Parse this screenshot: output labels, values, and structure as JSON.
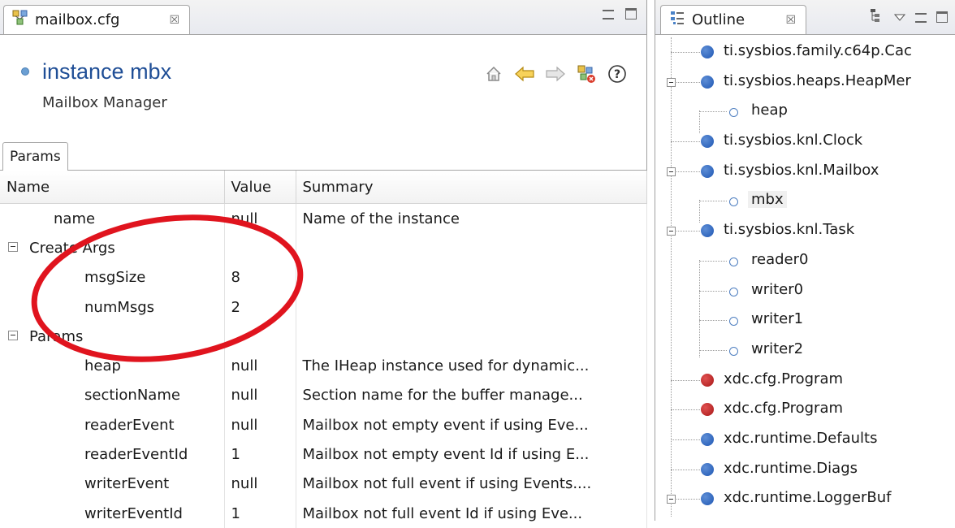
{
  "editor": {
    "tab_label": "mailbox.cfg",
    "tab_close": "☒",
    "instance_title": "instance mbx",
    "instance_subtitle": "Mailbox Manager",
    "params_tab": "Params",
    "columns": [
      "Name",
      "Value",
      "Summary"
    ],
    "rows": [
      {
        "name": "name",
        "value": "null",
        "summary": "Name of the instance",
        "level": 1
      },
      {
        "name": "Create Args",
        "value": "",
        "summary": "",
        "level": 0,
        "group": true
      },
      {
        "name": "msgSize",
        "value": "8",
        "summary": "",
        "level": 2
      },
      {
        "name": "numMsgs",
        "value": "2",
        "summary": "",
        "level": 2
      },
      {
        "name": "Params",
        "value": "",
        "summary": "",
        "level": 0,
        "group": true
      },
      {
        "name": "heap",
        "value": "null",
        "summary": "The IHeap instance used for dynamic...",
        "level": 2
      },
      {
        "name": "sectionName",
        "value": "null",
        "summary": "Section name for the buffer manage...",
        "level": 2
      },
      {
        "name": "readerEvent",
        "value": "null",
        "summary": "Mailbox not empty event if using Eve...",
        "level": 2
      },
      {
        "name": "readerEventId",
        "value": "1",
        "summary": "Mailbox not empty event Id if using E...",
        "level": 2
      },
      {
        "name": "writerEvent",
        "value": "null",
        "summary": "Mailbox not full event if using Events....",
        "level": 2
      },
      {
        "name": "writerEventId",
        "value": "1",
        "summary": "Mailbox not full event Id if using Eve...",
        "level": 2
      }
    ],
    "annotation_color": "#e0141e"
  },
  "outline": {
    "tab_label": "Outline",
    "tab_close": "☒",
    "items": [
      {
        "label": "ti.sysbios.family.c64p.Cac",
        "kind": "module",
        "color": "blue",
        "expandable": false
      },
      {
        "label": "ti.sysbios.heaps.HeapMer",
        "kind": "module",
        "color": "blue",
        "expandable": true
      },
      {
        "label": "heap",
        "kind": "instance",
        "color": "blue",
        "expandable": false
      },
      {
        "label": "ti.sysbios.knl.Clock",
        "kind": "module",
        "color": "blue",
        "expandable": false
      },
      {
        "label": "ti.sysbios.knl.Mailbox",
        "kind": "module",
        "color": "blue",
        "expandable": true
      },
      {
        "label": "mbx",
        "kind": "instance",
        "color": "blue",
        "expandable": false,
        "selected": true
      },
      {
        "label": "ti.sysbios.knl.Task",
        "kind": "module",
        "color": "blue",
        "expandable": true
      },
      {
        "label": "reader0",
        "kind": "instance",
        "color": "blue",
        "expandable": false
      },
      {
        "label": "writer0",
        "kind": "instance",
        "color": "blue",
        "expandable": false
      },
      {
        "label": "writer1",
        "kind": "instance",
        "color": "blue",
        "expandable": false
      },
      {
        "label": "writer2",
        "kind": "instance",
        "color": "blue",
        "expandable": false
      },
      {
        "label": "xdc.cfg.Program",
        "kind": "module",
        "color": "red",
        "expandable": false
      },
      {
        "label": "xdc.cfg.Program",
        "kind": "module",
        "color": "red",
        "expandable": false
      },
      {
        "label": "xdc.runtime.Defaults",
        "kind": "module",
        "color": "blue",
        "expandable": false
      },
      {
        "label": "xdc.runtime.Diags",
        "kind": "module",
        "color": "blue",
        "expandable": false
      },
      {
        "label": "xdc.runtime.LoggerBuf",
        "kind": "module",
        "color": "blue",
        "expandable": true
      }
    ]
  }
}
